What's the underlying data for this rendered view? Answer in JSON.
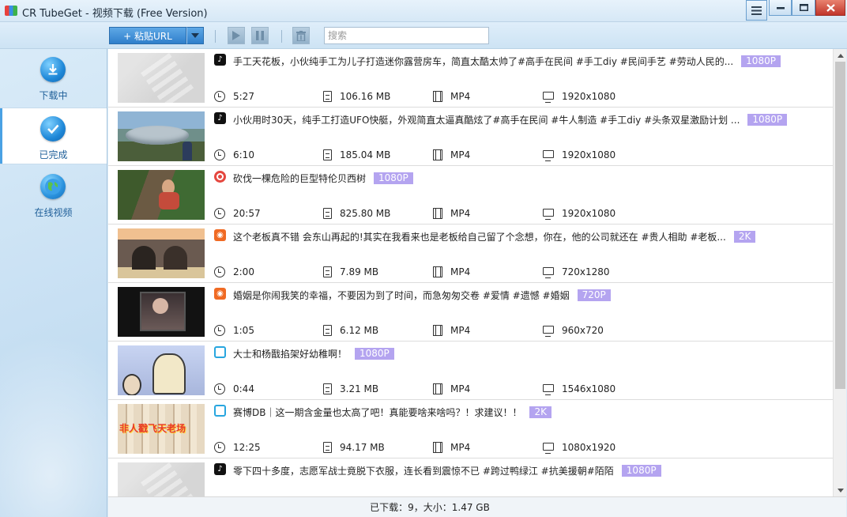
{
  "window": {
    "title": "CR TubeGet - 视频下载 (Free Version)"
  },
  "toolbar": {
    "paste_label": "+ 粘贴URL",
    "search_placeholder": "搜索"
  },
  "sidebar": {
    "items": [
      {
        "label": "下载中",
        "icon": "download-icon"
      },
      {
        "label": "已完成",
        "icon": "check-icon"
      },
      {
        "label": "在线视频",
        "icon": "globe-icon"
      }
    ],
    "active_index": 1
  },
  "videos": [
    {
      "title": "手工天花板，小伙纯手工为儿子打造迷你露营房车，简直太酷太帅了#高手在民间 #手工diy #民间手艺 #劳动人民的...",
      "quality": "1080P",
      "duration": "5:27",
      "size": "106.16 MB",
      "format": "MP4",
      "resolution": "1920x1080",
      "source": "tiktok-icon",
      "thumb": "placeholder"
    },
    {
      "title": "小伙用时30天，纯手工打造UFO快艇，外观简直太逼真酷炫了#高手在民间 #牛人制造 #手工diy #头条双星激励计划 ...",
      "quality": "1080P",
      "duration": "6:10",
      "size": "185.04 MB",
      "format": "MP4",
      "resolution": "1920x1080",
      "source": "tiktok-icon",
      "thumb": "ufo"
    },
    {
      "title": "砍伐一棵危险的巨型特伦贝西树",
      "quality": "1080P",
      "duration": "20:57",
      "size": "825.80 MB",
      "format": "MP4",
      "resolution": "1920x1080",
      "source": "record-icon",
      "thumb": "tree"
    },
    {
      "title": "这个老板真不错 会东山再起的!其实在我看来也是老板给自己留了个念想，你在，他的公司就还在 #贵人相助 #老板...",
      "quality": "2K",
      "duration": "2:00",
      "size": "7.89 MB",
      "format": "MP4",
      "resolution": "720x1280",
      "source": "kuaishou-icon",
      "thumb": "boss"
    },
    {
      "title": "婚姻是你闹我笑的幸福，不要因为到了时间，而急匆匆交卷 #爱情 #遗憾  #婚姻",
      "quality": "720P",
      "duration": "1:05",
      "size": "6.12 MB",
      "format": "MP4",
      "resolution": "960x720",
      "source": "kuaishou-icon",
      "thumb": "tv"
    },
    {
      "title": "大士和杨戬掐架好幼稚啊！",
      "quality": "1080P",
      "duration": "0:44",
      "size": "3.21 MB",
      "format": "MP4",
      "resolution": "1546x1080",
      "source": "bilibili-icon",
      "thumb": "anime"
    },
    {
      "title": "赛博DB｜这一期含金量也太高了吧！真能要啥来啥吗？！求建议！！",
      "quality": "2K",
      "duration": "12:25",
      "size": "94.17 MB",
      "format": "MP4",
      "resolution": "1080x1920",
      "source": "bilibili-icon",
      "thumb": "comic"
    },
    {
      "title": "零下四十多度，志愿军战士竟脱下衣服，连长看到震惊不已 #跨过鸭绿江 #抗美援朝#陌陌",
      "quality": "1080P",
      "duration": "",
      "size": "",
      "format": "",
      "resolution": "",
      "source": "tiktok-icon",
      "thumb": "placeholder"
    }
  ],
  "status": {
    "text": "已下载：9，大小：1.47 GB"
  },
  "colors": {
    "quality_badge": "#b4a4f0",
    "accent": "#2f7fcb"
  }
}
